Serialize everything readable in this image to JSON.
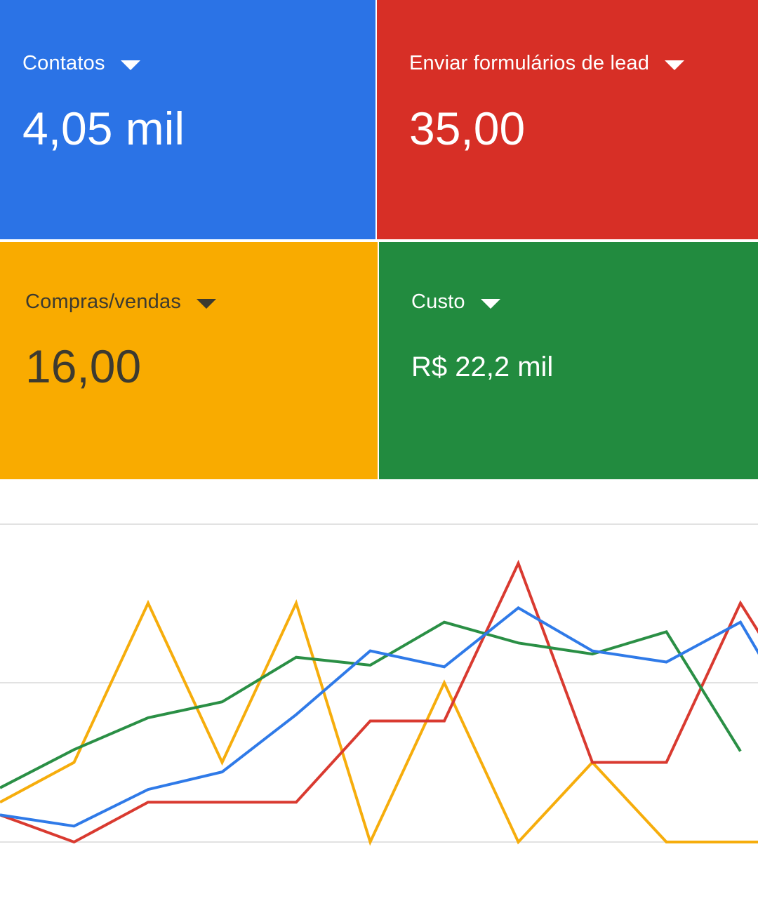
{
  "tiles": [
    {
      "id": "contatos",
      "label": "Contatos",
      "value": "4,05 mil",
      "bg": "#2b73e6",
      "fg": "#ffffff",
      "line": "#2f7ae8"
    },
    {
      "id": "formularios",
      "label": "Enviar formulários de lead",
      "value": "35,00",
      "bg": "#d72f26",
      "fg": "#ffffff",
      "line": "#d93a30"
    },
    {
      "id": "compras",
      "label": "Compras/vendas",
      "value": "16,00",
      "bg": "#f9ab00",
      "fg": "#3c3a30",
      "line": "#f6ad0c"
    },
    {
      "id": "custo",
      "label": "Custo",
      "value": "R$ 22,2 mil",
      "bg": "#228b3f",
      "fg": "#ffffff",
      "line": "#2a8f45"
    }
  ],
  "icons": {
    "dropdown": "caret-down-icon"
  },
  "gridline_color": "#e2e2e2",
  "chart_data": {
    "type": "line",
    "x": [
      0,
      1,
      2,
      3,
      4,
      5,
      6,
      7,
      8,
      9,
      10,
      11
    ],
    "ylim": [
      0,
      1
    ],
    "series": [
      {
        "values": [
          0.17,
          0.1,
          0.33,
          0.44,
          0.8,
          1.2,
          1.1,
          1.47,
          1.2,
          1.13,
          1.38,
          0.59
        ]
      },
      {
        "values": [
          0.17,
          0.0,
          0.25,
          0.25,
          0.25,
          0.76,
          0.76,
          1.75,
          0.5,
          0.5,
          1.5,
          0.76
        ]
      },
      {
        "values": [
          0.25,
          0.5,
          1.5,
          0.5,
          1.5,
          0.0,
          1.0,
          0.0,
          0.5,
          0.0,
          0.0,
          0.0
        ]
      },
      {
        "values": [
          0.34,
          0.58,
          0.78,
          0.88,
          1.16,
          1.11,
          1.38,
          1.25,
          1.18,
          1.32,
          0.57
        ]
      }
    ]
  }
}
